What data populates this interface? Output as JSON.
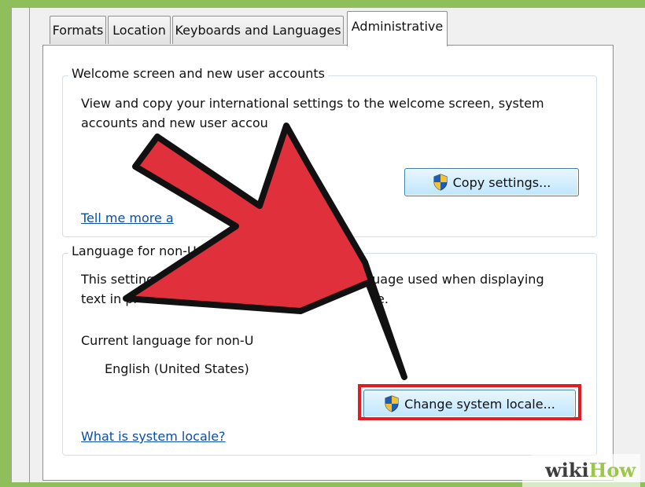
{
  "tabs": [
    "Formats",
    "Location",
    "Keyboards and Languages",
    "Administrative"
  ],
  "welcome": {
    "title": "Welcome screen and new user accounts",
    "desc_line1": "View and copy your international settings to the welcome screen, system",
    "desc_line2": "accounts and new user accou",
    "copy_button": "Copy settings...",
    "link": "Tell me more a"
  },
  "language": {
    "title": "Language for non-Un",
    "desc_line1_a": "This setting (",
    "desc_line1_b": "guage used when displaying",
    "desc_line2_a": "text in pr",
    "desc_line2_b": "e.",
    "current_label": "Current language for non-U",
    "current_value": "English (United States)",
    "change_button": "Change system locale...",
    "link": "What is system locale?"
  },
  "watermark": {
    "wiki": "wiki",
    "how": "How"
  },
  "colors": {
    "arrow": "#e0303c",
    "highlight": "#e21b23",
    "link": "#0a4ea8",
    "background": "#8fbf5a"
  }
}
